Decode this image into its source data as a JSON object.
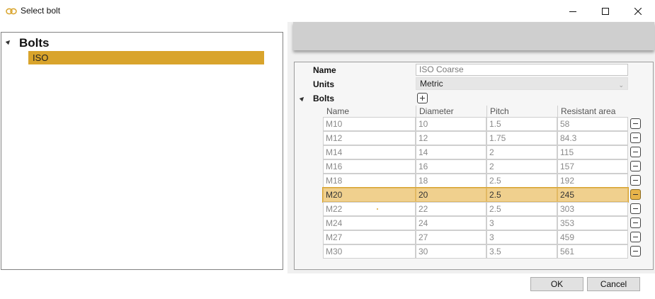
{
  "window": {
    "title": "Select bolt",
    "icon": "linked-rings-icon"
  },
  "colors": {
    "accent": "#d9a42c",
    "selected_row": "#f0d08e",
    "header_band": "#cfcfcf"
  },
  "tree": {
    "root_label": "Bolts",
    "items": [
      {
        "label": "ISO",
        "selected": true
      }
    ]
  },
  "properties": {
    "name_label": "Name",
    "name_value": "ISO Coarse",
    "units_label": "Units",
    "units_value": "Metric",
    "bolts_label": "Bolts"
  },
  "grid": {
    "columns": [
      "Name",
      "Diameter",
      "Pitch",
      "Resistant area"
    ],
    "rows": [
      {
        "name": "M10",
        "diameter": "10",
        "pitch": "1.5",
        "area": "58"
      },
      {
        "name": "M12",
        "diameter": "12",
        "pitch": "1.75",
        "area": "84.3"
      },
      {
        "name": "M14",
        "diameter": "14",
        "pitch": "2",
        "area": "115"
      },
      {
        "name": "M16",
        "diameter": "16",
        "pitch": "2",
        "area": "157"
      },
      {
        "name": "M18",
        "diameter": "18",
        "pitch": "2.5",
        "area": "192"
      },
      {
        "name": "M20",
        "diameter": "20",
        "pitch": "2.5",
        "area": "245",
        "selected": true
      },
      {
        "name": "M22",
        "diameter": "22",
        "pitch": "2.5",
        "area": "303"
      },
      {
        "name": "M24",
        "diameter": "24",
        "pitch": "3",
        "area": "353"
      },
      {
        "name": "M27",
        "diameter": "27",
        "pitch": "3",
        "area": "459"
      },
      {
        "name": "M30",
        "diameter": "30",
        "pitch": "3.5",
        "area": "561"
      }
    ]
  },
  "footer": {
    "ok_label": "OK",
    "cancel_label": "Cancel"
  }
}
